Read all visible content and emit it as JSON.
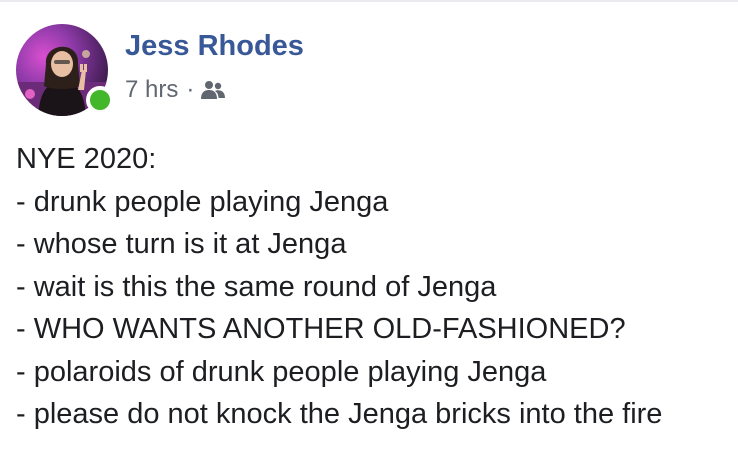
{
  "post": {
    "author": "Jess Rhodes",
    "timestamp": "7 hrs",
    "separator": "·",
    "audience_icon": "friends-icon",
    "online_status": "online",
    "lines": [
      "NYE 2020:",
      "- drunk people playing Jenga",
      "- whose turn is it at Jenga",
      "- wait is this the same round of Jenga",
      "- WHO WANTS ANOTHER OLD-FASHIONED?",
      "- polaroids of drunk people playing Jenga",
      "- please do not knock the Jenga bricks into the fire"
    ]
  },
  "colors": {
    "author_link": "#385898",
    "meta_text": "#616770",
    "body_text": "#1c1e21",
    "online_dot": "#42b72a"
  }
}
